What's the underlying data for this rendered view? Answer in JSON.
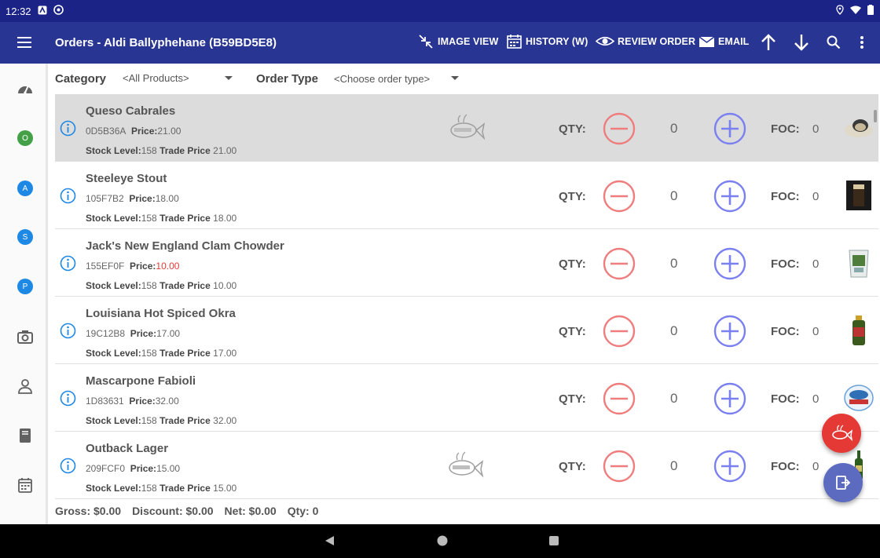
{
  "statusbar": {
    "time": "12:32"
  },
  "appbar": {
    "title": "Orders - Aldi Ballyphehane (B59BD5E8)",
    "actions": {
      "image_view": "IMAGE VIEW",
      "history": "HISTORY (W)",
      "review_order": "REVIEW ORDER",
      "email": "EMAIL"
    }
  },
  "sidebar": {
    "items": [
      {
        "letter": "O",
        "color": "#43a047"
      },
      {
        "letter": "A",
        "color": "#1e88e5"
      },
      {
        "letter": "S",
        "color": "#1e88e5"
      },
      {
        "letter": "P",
        "color": "#1e88e5"
      }
    ]
  },
  "filters": {
    "category_label": "Category",
    "category_value": "<All Products>",
    "order_type_label": "Order Type",
    "order_type_value": "<Choose order type>"
  },
  "labels": {
    "price": "Price:",
    "stock_level": "Stock Level:",
    "trade_price": "Trade Price",
    "qty": "QTY:",
    "foc": "FOC:"
  },
  "products": [
    {
      "name": "Queso Cabrales",
      "code": "0D5B36A",
      "price": "21.00",
      "stock": "158",
      "trade_price": "21.00",
      "qty": "0",
      "foc": "0",
      "price_red": false
    },
    {
      "name": "Steeleye Stout",
      "code": "105F7B2",
      "price": "18.00",
      "stock": "158",
      "trade_price": "18.00",
      "qty": "0",
      "foc": "0",
      "price_red": false
    },
    {
      "name": "Jack's New England Clam Chowder",
      "code": "155EF0F",
      "price": "10.00",
      "stock": "158",
      "trade_price": "10.00",
      "qty": "0",
      "foc": "0",
      "price_red": true
    },
    {
      "name": "Louisiana Hot Spiced Okra",
      "code": "19C12B8",
      "price": "17.00",
      "stock": "158",
      "trade_price": "17.00",
      "qty": "0",
      "foc": "0",
      "price_red": false
    },
    {
      "name": "Mascarpone Fabioli",
      "code": "1D83631",
      "price": "32.00",
      "stock": "158",
      "trade_price": "32.00",
      "qty": "0",
      "foc": "0",
      "price_red": false
    },
    {
      "name": "Outback Lager",
      "code": "209FCF0",
      "price": "15.00",
      "stock": "158",
      "trade_price": "15.00",
      "qty": "0",
      "foc": "0",
      "price_red": false
    }
  ],
  "totals": {
    "gross": "Gross: $0.00",
    "discount": "Discount: $0.00",
    "net": "Net: $0.00",
    "qty": "Qty: 0"
  },
  "colors": {
    "appbar": "#283593",
    "statusbar": "#1b2387",
    "minus": "#ef7d7d",
    "plus": "#7b80f0",
    "info": "#1e88e5",
    "fab_red": "#e53935",
    "fab_blue": "#5c6bc0"
  }
}
